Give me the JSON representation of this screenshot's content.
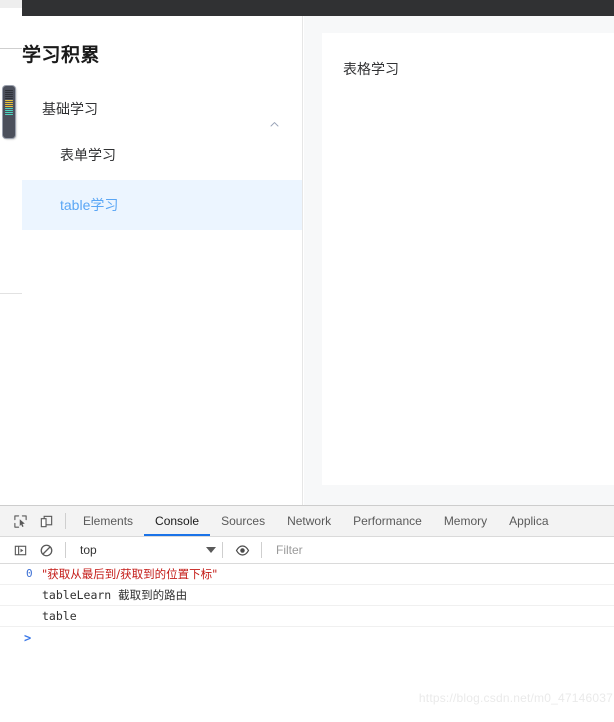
{
  "page": {
    "site_title": "学习积累",
    "menu": {
      "group_label": "基础学习",
      "items": [
        {
          "label": "表单学习",
          "active": false
        },
        {
          "label": "table学习",
          "active": true
        }
      ]
    },
    "content": {
      "card_title": "表格学习"
    }
  },
  "devtools": {
    "tabs": [
      {
        "label": "Elements",
        "active": false
      },
      {
        "label": "Console",
        "active": true
      },
      {
        "label": "Sources",
        "active": false
      },
      {
        "label": "Network",
        "active": false
      },
      {
        "label": "Performance",
        "active": false
      },
      {
        "label": "Memory",
        "active": false
      },
      {
        "label": "Applica",
        "active": false
      }
    ],
    "toolbar": {
      "context": "top",
      "filter_placeholder": "Filter"
    },
    "console": {
      "rows": [
        {
          "badge": "0",
          "text": "\"获取从最后到/获取到的位置下标\"",
          "style": "error-string"
        },
        {
          "badge": "",
          "text": "tableLearn 截取到的路由",
          "style": "log"
        },
        {
          "badge": "",
          "text": "table",
          "style": "log"
        }
      ],
      "prompt_symbol": ">"
    }
  },
  "watermark": "https://blog.csdn.net/m0_47146037",
  "colors": {
    "accent_blue": "#409eff",
    "active_menu_bg": "#ecf5ff",
    "devtools_active_tab": "#1a73e8",
    "top_bar": "#303133",
    "console_error": "#c41a16"
  }
}
